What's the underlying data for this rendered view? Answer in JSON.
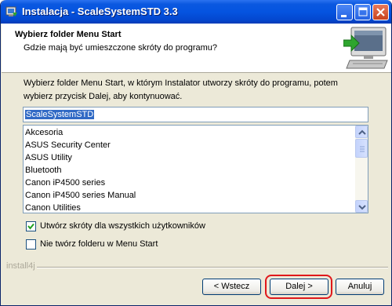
{
  "window": {
    "title": "Instalacja - ScaleSystemSTD 3.3"
  },
  "header": {
    "title": "Wybierz folder Menu Start",
    "subtitle": "Gdzie mają być umieszczone skróty do programu?"
  },
  "main": {
    "instruction": "Wybierz folder Menu Start, w którym Instalator utworzy skróty do programu, potem wybierz przycisk Dalej, aby kontynuować.",
    "folder_value": "ScaleSystemSTD",
    "folder_list": [
      "Akcesoria",
      "ASUS Security Center",
      "ASUS Utility",
      "Bluetooth",
      "Canon iP4500 series",
      "Canon iP4500 series Manual",
      "Canon Utilities"
    ],
    "checkbox_all_users": {
      "label": "Utwórz skróty dla wszystkich użytkowników",
      "checked": true
    },
    "checkbox_no_folder": {
      "label": "Nie twórz folderu w Menu Start",
      "checked": false
    }
  },
  "footer": {
    "brand": "install4j",
    "back_label": "< Wstecz",
    "next_label": "Dalej >",
    "cancel_label": "Anuluj"
  },
  "icons": {
    "app": "installer-app-icon",
    "header": "computer-install-icon",
    "minimize": "minimize-icon",
    "maximize": "maximize-icon",
    "close": "close-icon"
  },
  "colors": {
    "titlebar": "#0554e0",
    "selection": "#316ac5",
    "highlight_ring": "#e0181b",
    "checkmark": "#21a121"
  }
}
